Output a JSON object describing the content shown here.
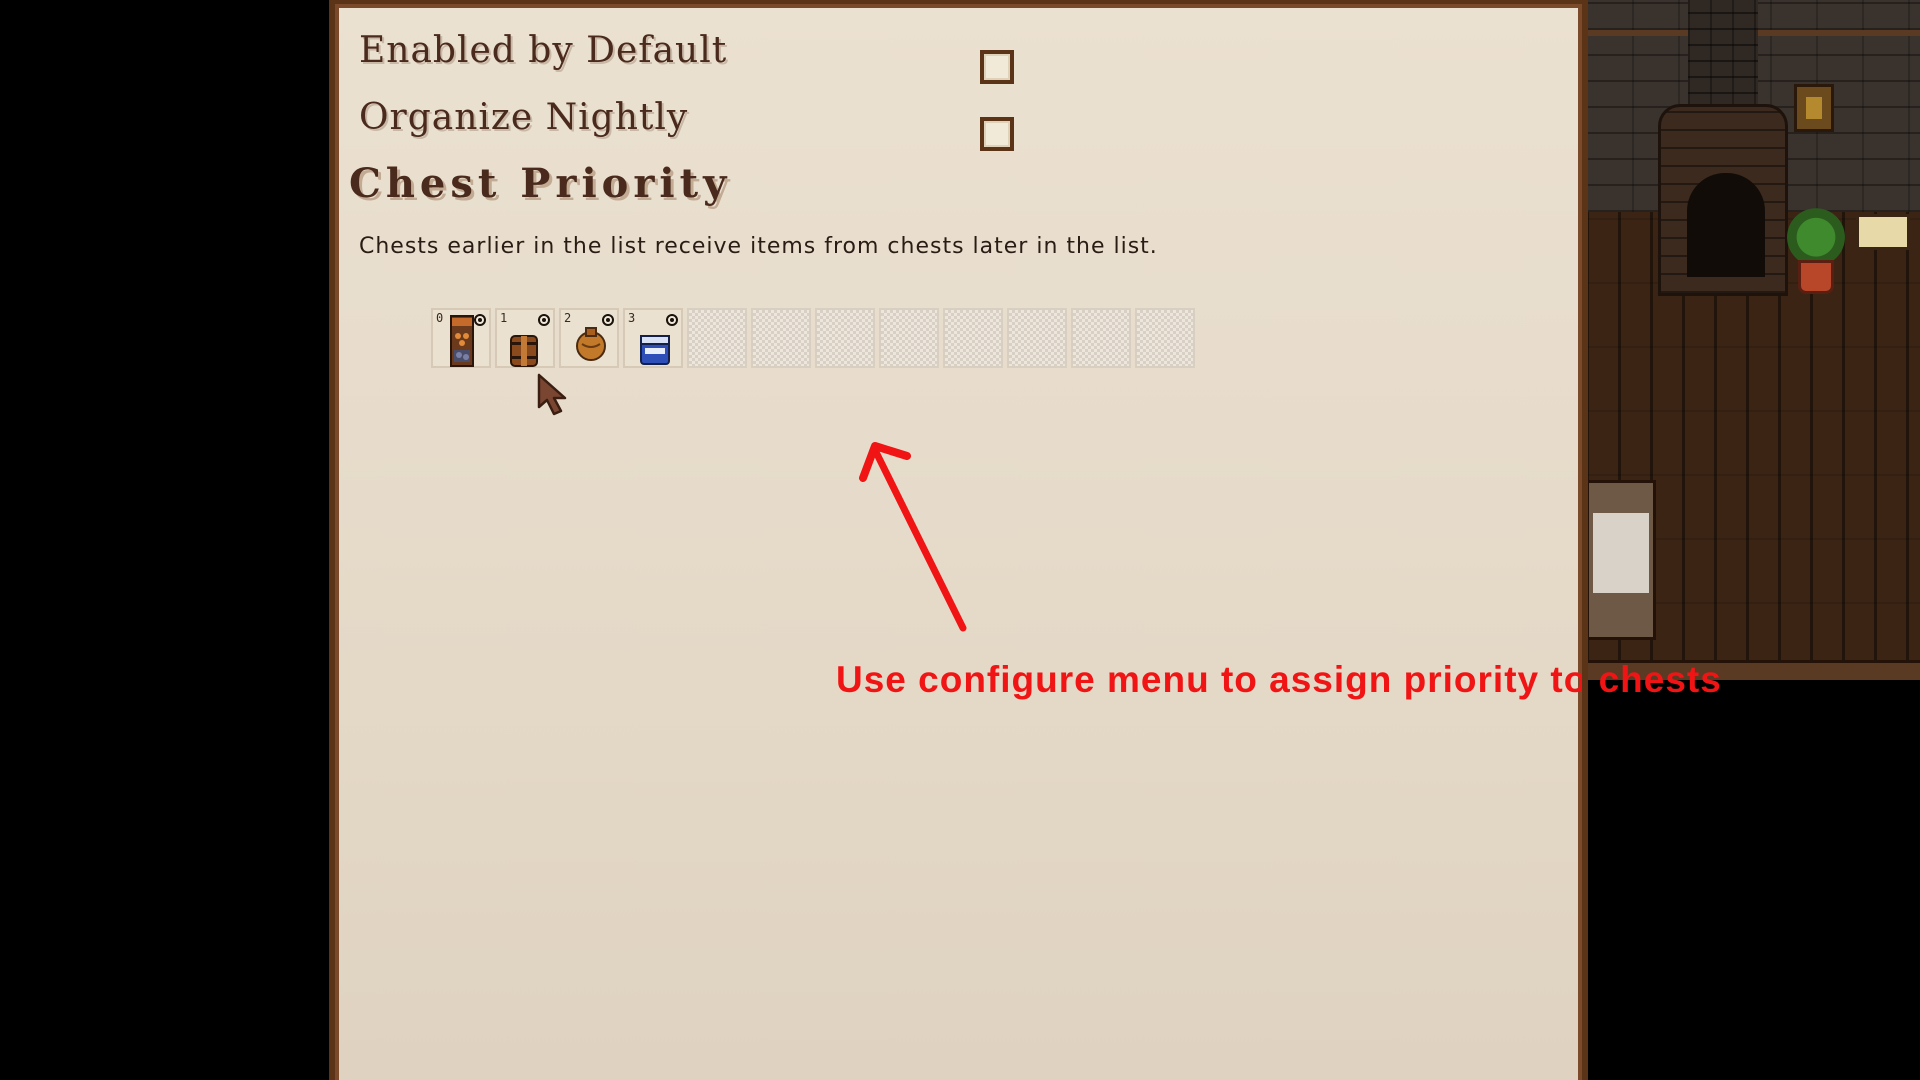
{
  "options": {
    "enabled_by_default": {
      "label": "Enabled by Default",
      "checked": false
    },
    "organize_nightly": {
      "label": "Organize Nightly",
      "checked": false
    }
  },
  "chest_priority": {
    "title": "Chest Priority",
    "description": "Chests earlier in the list receive items from chests later in the list.",
    "slots": [
      {
        "index": "0",
        "item": "tall-furniture-chest-icon",
        "configured": true
      },
      {
        "index": "1",
        "item": "wooden-barrel-chest-icon",
        "configured": true
      },
      {
        "index": "2",
        "item": "sack-icon",
        "configured": true
      },
      {
        "index": "3",
        "item": "blue-cooler-chest-icon",
        "configured": true
      },
      {
        "index": "",
        "item": "empty-slot"
      },
      {
        "index": "",
        "item": "empty-slot"
      },
      {
        "index": "",
        "item": "empty-slot"
      },
      {
        "index": "",
        "item": "empty-slot"
      },
      {
        "index": "",
        "item": "empty-slot"
      },
      {
        "index": "",
        "item": "empty-slot"
      },
      {
        "index": "",
        "item": "empty-slot"
      },
      {
        "index": "",
        "item": "empty-slot"
      }
    ]
  },
  "annotation": {
    "text": "Use configure menu to assign priority to chests",
    "color": "#f01414"
  },
  "colors": {
    "panel_background": "#e7dccb",
    "panel_border": "#5b3418",
    "label_text": "#4a2a1c"
  }
}
